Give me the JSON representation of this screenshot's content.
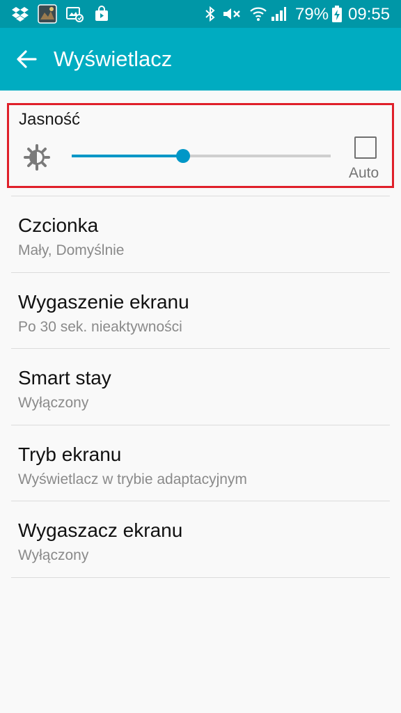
{
  "status_bar": {
    "battery_percent": "79%",
    "time": "09:55",
    "icons": [
      "dropbox-icon",
      "game-thumbnail-icon",
      "gallery-notification-icon",
      "store-bag-icon",
      "bluetooth-icon",
      "mute-icon",
      "wifi-icon",
      "signal-icon",
      "battery-charging-icon"
    ]
  },
  "app_bar": {
    "back_icon": "arrow-back-icon",
    "title": "Wyświetlacz"
  },
  "brightness": {
    "label": "Jasność",
    "icon": "brightness-icon",
    "level": 0.43,
    "auto_label": "Auto",
    "auto_checked": false
  },
  "settings": [
    {
      "title": "Czcionka",
      "subtitle": "Mały, Domyślnie"
    },
    {
      "title": "Wygaszenie ekranu",
      "subtitle": "Po 30 sek. nieaktywności"
    },
    {
      "title": "Smart stay",
      "subtitle": "Wyłączony"
    },
    {
      "title": "Tryb ekranu",
      "subtitle": "Wyświetlacz w trybie adaptacyjnym"
    },
    {
      "title": "Wygaszacz ekranu",
      "subtitle": "Wyłączony"
    }
  ],
  "colors": {
    "status_bar": "#0097a7",
    "app_bar": "#00acc1",
    "accent": "#0097c7",
    "highlight_border": "#e0202a"
  }
}
